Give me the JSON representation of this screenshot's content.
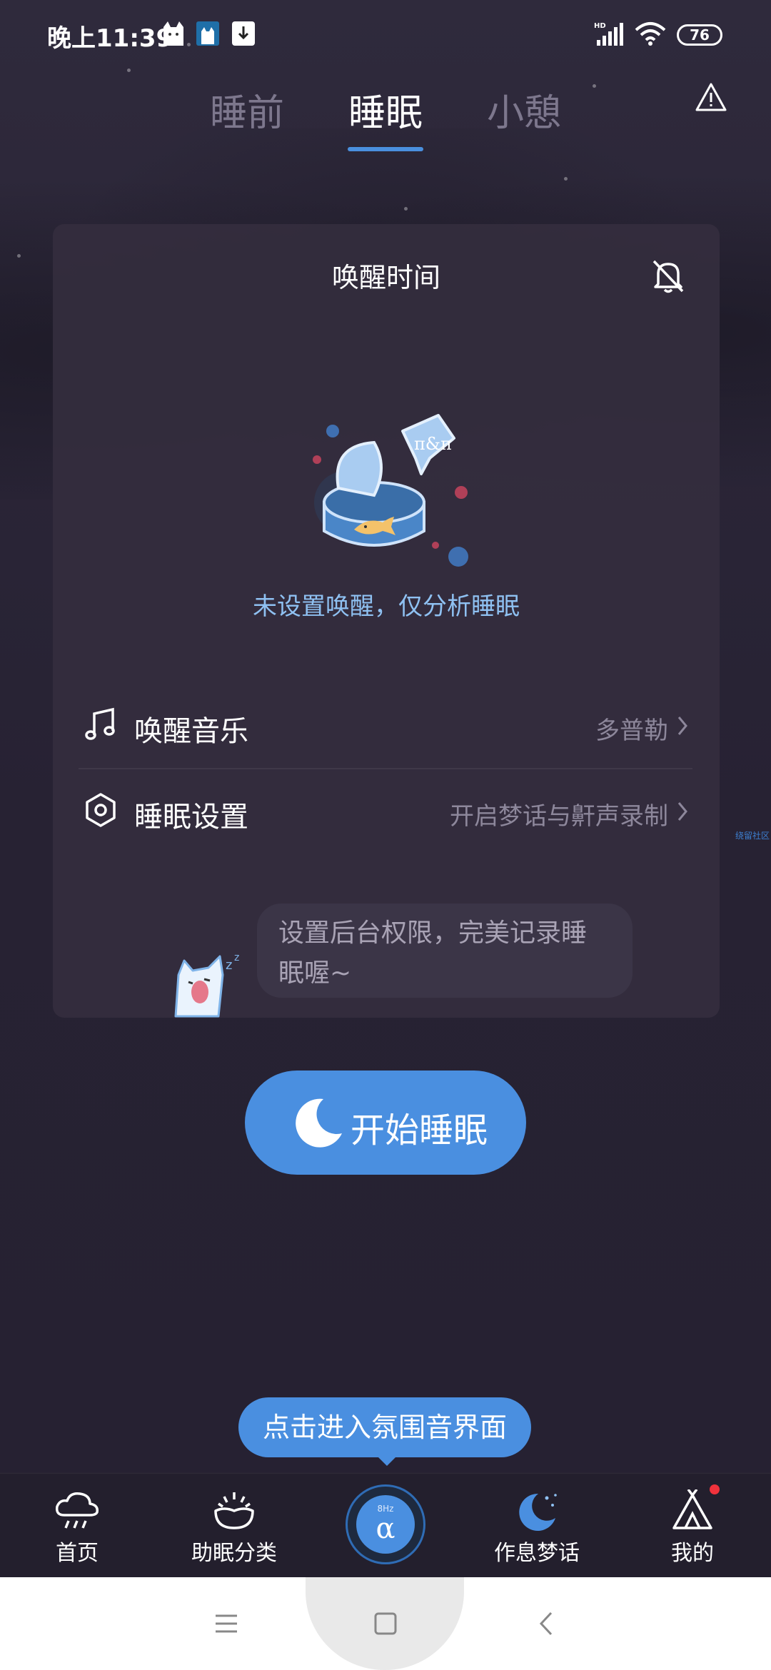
{
  "status_bar": {
    "time": "晚上11:39",
    "battery": "76",
    "icons": [
      "cat-app-icon",
      "blue-app-icon",
      "download-icon",
      "hd-signal-icon",
      "wifi-icon",
      "battery-icon"
    ]
  },
  "tabs": [
    {
      "label": "睡前",
      "active": false
    },
    {
      "label": "睡眠",
      "active": true
    },
    {
      "label": "小憩",
      "active": false
    }
  ],
  "card": {
    "title": "唤醒时间",
    "no_alarm_text": "未设置唤醒，仅分析睡眠",
    "bubble_label": "π&π",
    "rows": [
      {
        "icon": "music-note-icon",
        "label": "唤醒音乐",
        "value": "多普勒"
      },
      {
        "icon": "hexagon-settings-icon",
        "label": "睡眠设置",
        "value": "开启梦话与鼾声录制"
      }
    ],
    "tip_bubble": "设置后台权限，完美记录睡眠喔~"
  },
  "side_link": "绕留社区",
  "start_button": {
    "label": "开始睡眠",
    "icon": "moon-icon"
  },
  "tooltip": "点击进入氛围音界面",
  "bottom_nav": {
    "items": [
      {
        "label": "首页",
        "icon": "rain-cloud-icon",
        "active": false
      },
      {
        "label": "助眠分类",
        "icon": "bowl-icon",
        "active": false
      },
      {
        "label": "作息梦话",
        "icon": "moon-stars-icon",
        "active": true
      },
      {
        "label": "我的",
        "icon": "tent-icon",
        "active": false
      }
    ],
    "center": {
      "hz": "8Hz",
      "symbol": "α"
    }
  },
  "colors": {
    "accent": "#4a8fe0",
    "background": "#272233",
    "card": "#342e3e",
    "link_blue": "#8fc1f2",
    "badge_red": "#f0323c"
  }
}
